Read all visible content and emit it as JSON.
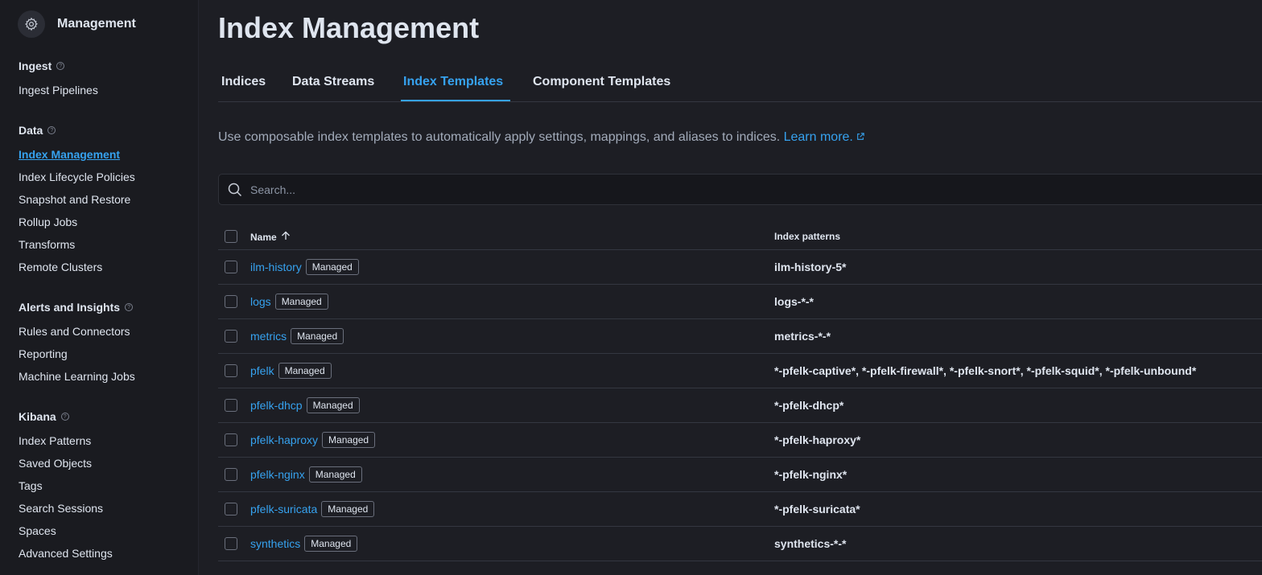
{
  "sidebar": {
    "title": "Management",
    "groups": [
      {
        "title": "Ingest",
        "items": [
          "Ingest Pipelines"
        ]
      },
      {
        "title": "Data",
        "items": [
          "Index Management",
          "Index Lifecycle Policies",
          "Snapshot and Restore",
          "Rollup Jobs",
          "Transforms",
          "Remote Clusters"
        ]
      },
      {
        "title": "Alerts and Insights",
        "items": [
          "Rules and Connectors",
          "Reporting",
          "Machine Learning Jobs"
        ]
      },
      {
        "title": "Kibana",
        "items": [
          "Index Patterns",
          "Saved Objects",
          "Tags",
          "Search Sessions",
          "Spaces",
          "Advanced Settings"
        ]
      }
    ],
    "active_item": "Index Management"
  },
  "page": {
    "title": "Index Management",
    "tabs": [
      "Indices",
      "Data Streams",
      "Index Templates",
      "Component Templates"
    ],
    "active_tab": "Index Templates",
    "description": "Use composable index templates to automatically apply settings, mappings, and aliases to indices.",
    "learn_more": "Learn more."
  },
  "search": {
    "placeholder": "Search...",
    "value": ""
  },
  "table": {
    "columns": {
      "name": "Name",
      "patterns": "Index patterns"
    },
    "badge": "Managed",
    "rows": [
      {
        "name": "ilm-history",
        "badge": "Managed",
        "patterns": "ilm-history-5*"
      },
      {
        "name": "logs",
        "badge": "Managed",
        "patterns": "logs-*-*"
      },
      {
        "name": "metrics",
        "badge": "Managed",
        "patterns": "metrics-*-*"
      },
      {
        "name": "pfelk",
        "badge": "Managed",
        "patterns": "*-pfelk-captive*, *-pfelk-firewall*, *-pfelk-snort*, *-pfelk-squid*, *-pfelk-unbound*"
      },
      {
        "name": "pfelk-dhcp",
        "badge": "Managed",
        "patterns": "*-pfelk-dhcp*"
      },
      {
        "name": "pfelk-haproxy",
        "badge": "Managed",
        "patterns": "*-pfelk-haproxy*"
      },
      {
        "name": "pfelk-nginx",
        "badge": "Managed",
        "patterns": "*-pfelk-nginx*"
      },
      {
        "name": "pfelk-suricata",
        "badge": "Managed",
        "patterns": "*-pfelk-suricata*"
      },
      {
        "name": "synthetics",
        "badge": "Managed",
        "patterns": "synthetics-*-*"
      }
    ]
  },
  "colors": {
    "accent": "#36a2ef",
    "background": "#1d1e24",
    "sidebar": "#1a1b20"
  }
}
